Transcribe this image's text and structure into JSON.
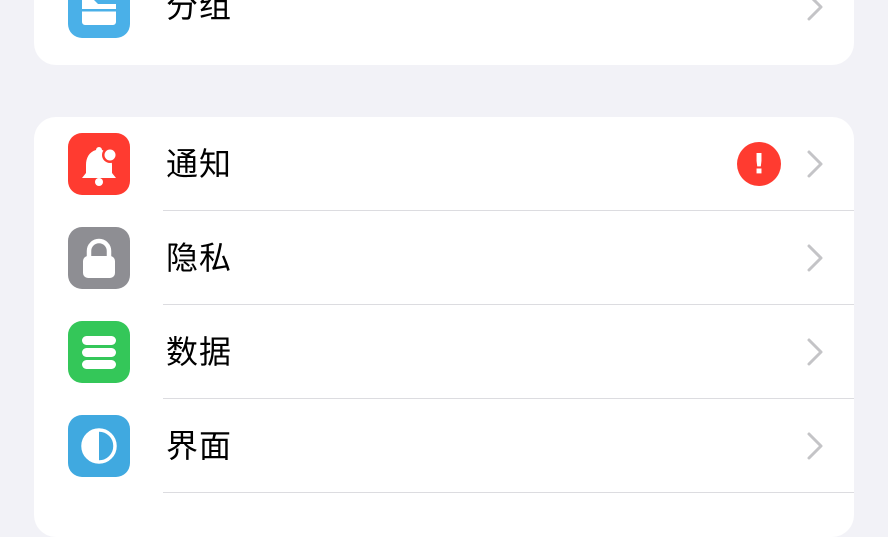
{
  "colors": {
    "background": "#f2f2f7",
    "card": "#ffffff",
    "separator": "#dcdce0",
    "chevron": "#c4c4c7",
    "alert": "#ff3b30"
  },
  "settings": {
    "top_group": [
      {
        "label": "分组",
        "icon": "folder-icon",
        "icon_color": "#4ab0e8"
      }
    ],
    "main_group": [
      {
        "label": "通知",
        "icon": "bell-icon",
        "icon_color": "#ff3b30",
        "badge": "!"
      },
      {
        "label": "隐私",
        "icon": "lock-icon",
        "icon_color": "#8e8e93"
      },
      {
        "label": "数据",
        "icon": "database-icon",
        "icon_color": "#34c759"
      },
      {
        "label": "界面",
        "icon": "half-circle-icon",
        "icon_color": "#40a9e0"
      }
    ]
  }
}
